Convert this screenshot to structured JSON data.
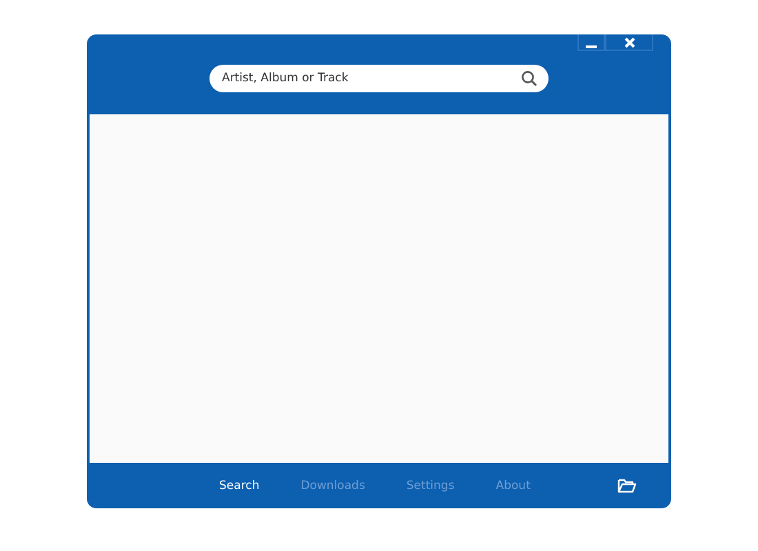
{
  "search": {
    "placeholder": "Artist, Album or Track"
  },
  "nav": [
    {
      "label": "Search",
      "selected": true
    },
    {
      "label": "Downloads",
      "selected": false
    },
    {
      "label": "Settings",
      "selected": false
    },
    {
      "label": "About",
      "selected": false
    }
  ]
}
